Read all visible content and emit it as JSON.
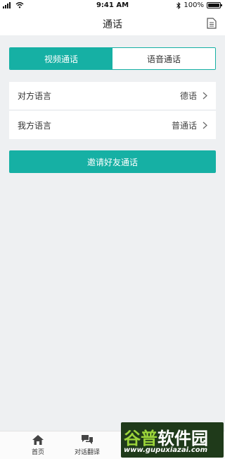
{
  "status_bar": {
    "time": "9:41 AM",
    "battery_label": "100%",
    "battery_level": 1.0
  },
  "header": {
    "title": "通话"
  },
  "segmented_control": {
    "tabs": [
      {
        "label": "视频通话",
        "active": true
      },
      {
        "label": "语音通话",
        "active": false
      }
    ]
  },
  "languages": {
    "other": {
      "label": "对方语言",
      "value": "德语"
    },
    "mine": {
      "label": "我方语言",
      "value": "普通话"
    }
  },
  "invite_button": {
    "label": "邀请好友通话"
  },
  "tab_bar": {
    "items": [
      {
        "label": "首页",
        "icon": "home-icon"
      },
      {
        "label": "对话翻译",
        "icon": "chat-bubbles-icon"
      }
    ]
  },
  "watermark": {
    "title_part1": "谷普",
    "title_part2": "软件园",
    "url": "www.gupuxiazai.com"
  },
  "colors": {
    "accent": "#16b0a4",
    "background": "#eef0f2"
  }
}
